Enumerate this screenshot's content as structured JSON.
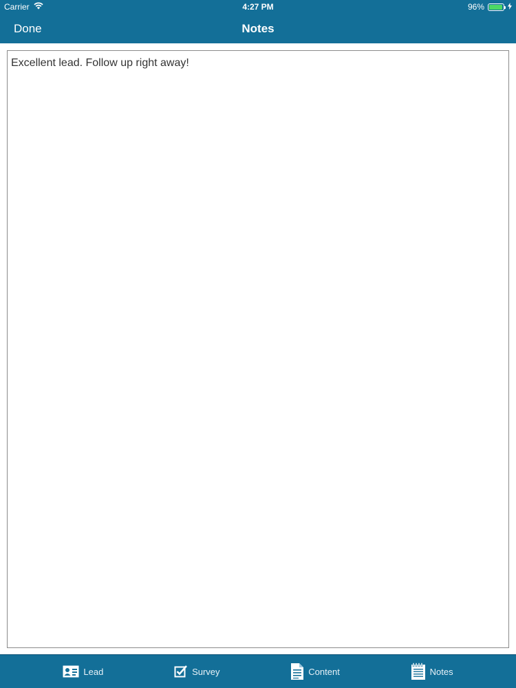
{
  "colors": {
    "brand": "#136f98",
    "battery": "#4cd964"
  },
  "status_bar": {
    "carrier": "Carrier",
    "time": "4:27 PM",
    "battery_level": "96%",
    "battery_fraction": 0.96
  },
  "nav_bar": {
    "done_label": "Done",
    "title": "Notes"
  },
  "notes": {
    "text": "Excellent lead. Follow up right away!"
  },
  "tab_bar": {
    "tabs": [
      {
        "label": "Lead",
        "icon": "contact-card-icon"
      },
      {
        "label": "Survey",
        "icon": "checkbox-icon"
      },
      {
        "label": "Content",
        "icon": "document-icon"
      },
      {
        "label": "Notes",
        "icon": "notepad-icon"
      }
    ]
  }
}
